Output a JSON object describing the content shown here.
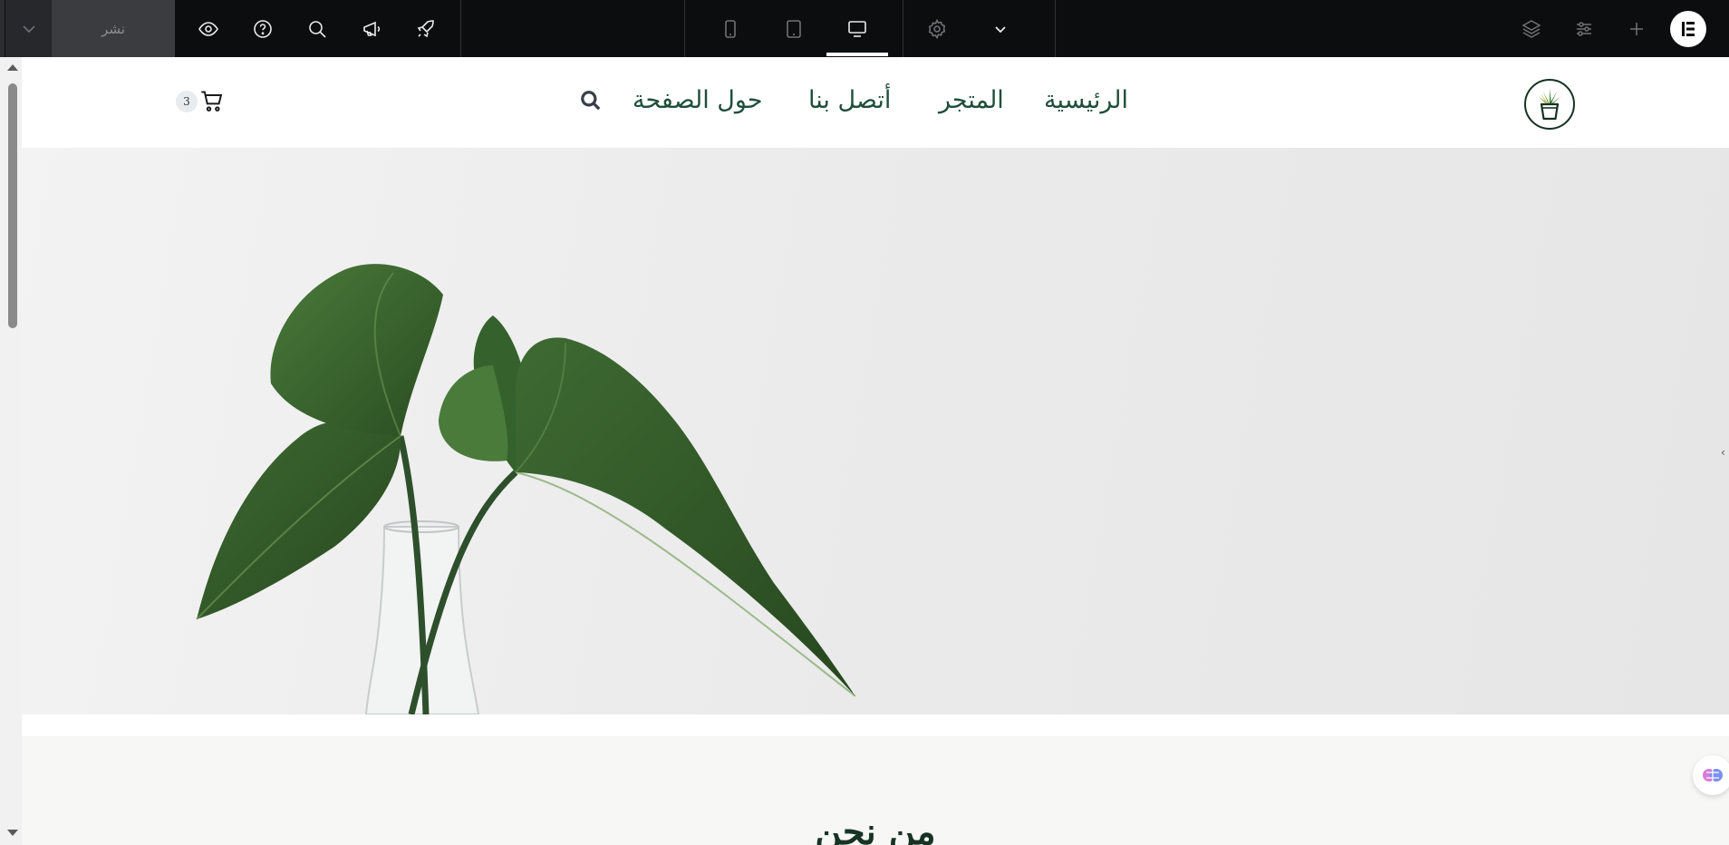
{
  "editor_toolbar": {
    "publish_label": "نشر",
    "publish_dropdown_icon": "chevron-down-icon",
    "tools": [
      "eye-icon",
      "help-icon",
      "search-icon",
      "announcement-icon",
      "rocket-icon"
    ],
    "devices": [
      "mobile-icon",
      "tablet-icon",
      "desktop-icon"
    ],
    "active_device": "desktop",
    "settings_icon": "gear-icon",
    "more_icon": "chevron-down-icon",
    "panel_tools": [
      "layers-icon",
      "sliders-icon",
      "plus-icon"
    ],
    "brand_icon": "elementor-logo"
  },
  "site": {
    "nav": {
      "home": "الرئيسية",
      "shop": "المتجر",
      "contact": "أتصل بنا",
      "about": "حول الصفحة"
    },
    "cart_count": "3",
    "colors": {
      "brand_green": "#1f4f3a",
      "dark_green": "#173324"
    }
  },
  "about": {
    "title": "من نحن"
  }
}
